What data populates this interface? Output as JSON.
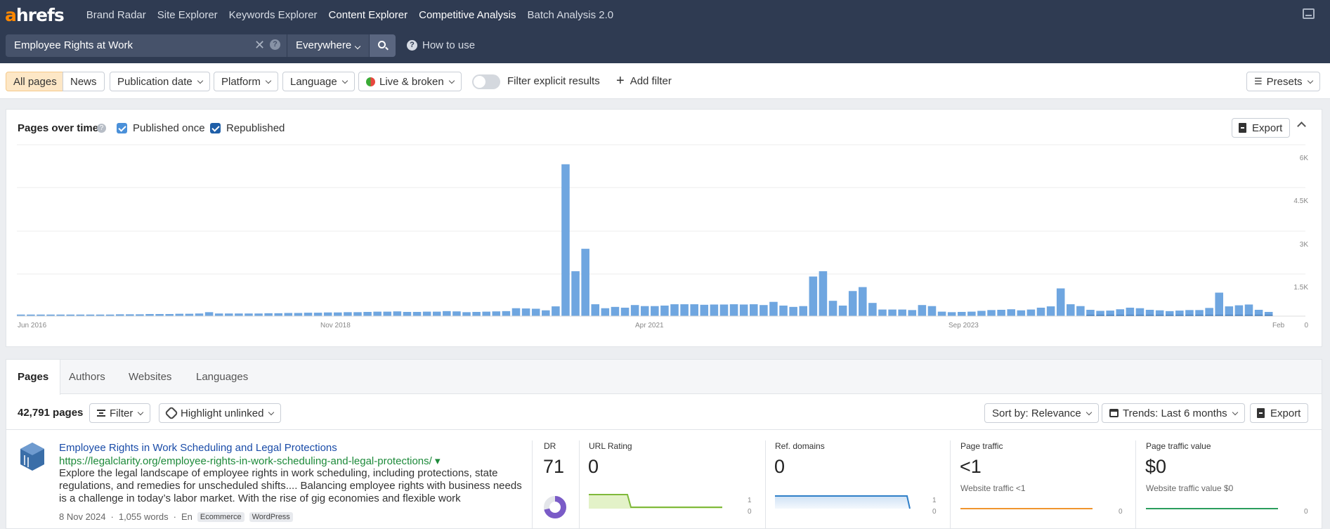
{
  "nav": {
    "logo_a": "a",
    "logo_rest": "hrefs",
    "items": [
      {
        "label": "Brand Radar"
      },
      {
        "label": "Site Explorer"
      },
      {
        "label": "Keywords Explorer"
      },
      {
        "label": "Content Explorer"
      },
      {
        "label": "Competitive Analysis"
      },
      {
        "label": "Batch Analysis 2.0"
      }
    ]
  },
  "search": {
    "query": "Employee Rights at Work",
    "scope": "Everywhere",
    "how_to_use": "How to use"
  },
  "filters": {
    "all_pages": "All pages",
    "news": "News",
    "publication_date": "Publication date",
    "platform": "Platform",
    "language": "Language",
    "live_broken": "Live & broken",
    "explicit_label": "Filter explicit results",
    "add_filter": "Add filter",
    "presets": "Presets"
  },
  "chart_panel": {
    "title": "Pages over time",
    "published_once": "Published once",
    "republished": "Republished",
    "export": "Export"
  },
  "chart_data": {
    "type": "bar",
    "title": "Pages over time",
    "x_ticks": [
      "Jun 2016",
      "Nov 2018",
      "Apr 2021",
      "Sep 2023",
      "Feb"
    ],
    "y_ticks": [
      "6K",
      "4.5K",
      "3K",
      "1.5K",
      "0"
    ],
    "ylim": [
      0,
      6000
    ],
    "grid": true,
    "colors": {
      "published_once": "#6fa6e0",
      "republished": "#1f5fa8"
    },
    "series": [
      {
        "name": "Published once",
        "values": [
          60,
          60,
          60,
          60,
          60,
          60,
          60,
          60,
          60,
          60,
          70,
          70,
          70,
          80,
          80,
          80,
          90,
          90,
          100,
          150,
          100,
          100,
          100,
          100,
          100,
          110,
          110,
          120,
          120,
          130,
          130,
          140,
          140,
          150,
          150,
          160,
          170,
          170,
          180,
          160,
          160,
          170,
          170,
          190,
          180,
          150,
          160,
          170,
          180,
          190,
          300,
          290,
          280,
          220,
          370,
          5750,
          1700,
          2550,
          450,
          300,
          350,
          320,
          420,
          380,
          380,
          400,
          450,
          450,
          450,
          430,
          440,
          440,
          450,
          440,
          450,
          420,
          540,
          400,
          350,
          380,
          1500,
          1700,
          580,
          400,
          950,
          1100,
          500,
          250,
          250,
          250,
          230,
          420,
          380,
          170,
          150,
          160,
          170,
          200,
          230,
          240,
          260,
          220,
          250,
          320,
          370,
          1050,
          450,
          380,
          200,
          160,
          170,
          220,
          280,
          260,
          200,
          180,
          150,
          170,
          190,
          190,
          270,
          850,
          330,
          370,
          400,
          200,
          120
        ]
      },
      {
        "name": "Republished",
        "values": [
          0,
          0,
          0,
          0,
          0,
          0,
          0,
          0,
          0,
          0,
          0,
          0,
          0,
          0,
          0,
          0,
          0,
          0,
          0,
          0,
          0,
          0,
          0,
          0,
          0,
          0,
          0,
          0,
          0,
          0,
          0,
          0,
          0,
          0,
          0,
          0,
          0,
          0,
          0,
          0,
          0,
          0,
          0,
          0,
          0,
          0,
          0,
          0,
          0,
          0,
          0,
          0,
          0,
          0,
          0,
          0,
          0,
          0,
          0,
          0,
          0,
          0,
          0,
          0,
          0,
          0,
          0,
          0,
          0,
          0,
          0,
          0,
          0,
          0,
          0,
          0,
          0,
          0,
          0,
          0,
          0,
          0,
          0,
          0,
          0,
          0,
          0,
          0,
          0,
          0,
          0,
          0,
          0,
          0,
          0,
          0,
          0,
          0,
          0,
          0,
          0,
          0,
          0,
          0,
          0,
          0,
          0,
          0,
          40,
          40,
          40,
          40,
          40,
          40,
          40,
          40,
          40,
          40,
          40,
          40,
          40,
          40,
          40,
          40,
          40,
          40,
          40
        ]
      }
    ]
  },
  "results": {
    "tabs": [
      "Pages",
      "Authors",
      "Websites",
      "Languages"
    ],
    "count": "42,791 pages",
    "filter": "Filter",
    "highlight": "Highlight unlinked",
    "sort": "Sort by: Relevance",
    "trends": "Trends: Last 6 months",
    "export": "Export",
    "row": {
      "title": "Employee Rights in Work Scheduling and Legal Protections",
      "url": "https://legalclarity.org/employee-rights-in-work-scheduling-and-legal-protections/ ▾",
      "desc": "Explore the legal landscape of employee rights in work scheduling, including protections, state regulations, and remedies for unscheduled shifts.... Balancing employee rights with business needs is a challenge in today’s labor market. With the rise of gig economies and flexible work",
      "date": "8 Nov 2024",
      "dot": "·",
      "words": "1,055 words",
      "lang": "En",
      "tags": [
        "Ecommerce",
        "WordPress"
      ],
      "dr_label": "DR",
      "dr_value": "71",
      "dr_fraction": 0.71,
      "ur_label": "URL Rating",
      "ur_value": "0",
      "ur_axis": [
        "1",
        "0"
      ],
      "rd_label": "Ref. domains",
      "rd_value": "0",
      "rd_axis": [
        "1",
        "0"
      ],
      "pt_label": "Page traffic",
      "pt_value": "<1",
      "pt_sub": "Website traffic <1",
      "pt_axis": "0",
      "ptv_label": "Page traffic value",
      "ptv_value": "$0",
      "ptv_sub": "Website traffic value $0",
      "ptv_axis": "0"
    }
  }
}
